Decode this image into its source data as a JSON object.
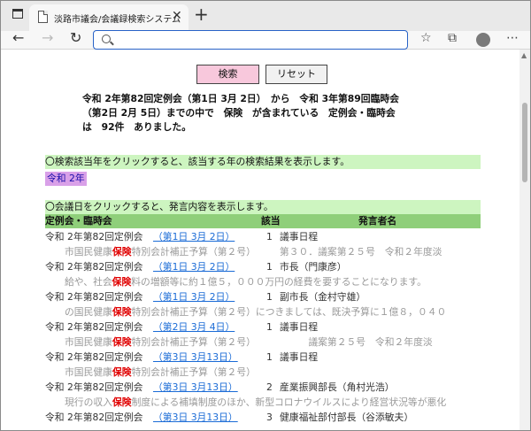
{
  "browser": {
    "tab_title": "淡路市議会/会議録検索システム",
    "close_glyph": "✕",
    "newtab_glyph": "+",
    "back_glyph": "←",
    "forward_glyph": "→",
    "reload_glyph": "↻",
    "addr_placeholder": ""
  },
  "search": {
    "button": "検索",
    "reset": "リセット"
  },
  "summary": [
    "令和 2年第82回定例会（第1日 3月 2日）　から　令和 3年第89回臨時会",
    "（第2日 2月 5日）までの中で　保険　が含まれている　定例会・臨時会",
    "は　92件　ありました。"
  ],
  "year_section": {
    "instruction": "〇検索該当年をクリックすると、該当する年の検索結果を表示します。",
    "year_link": "令和 2年"
  },
  "day_section": {
    "instruction": "〇会議日をクリックすると、発言内容を表示します。"
  },
  "table": {
    "headers": {
      "session": "定例会・臨時会",
      "count": "該当",
      "speaker": "発言者名"
    },
    "rows": [
      {
        "session": "令和 2年第82回定例会",
        "date": "（第1日 3月 2日）",
        "count": "1",
        "speaker": "議事日程",
        "excerpt": {
          "pre": "市国民健康",
          "kw": "保険",
          "post": "特別会計補正予算（第２号）　　　第３０．議案第２５号　令和２年度淡"
        }
      },
      {
        "session": "令和 2年第82回定例会",
        "date": "（第1日 3月 2日）",
        "count": "1",
        "speaker": "市長（門康彦）",
        "excerpt": {
          "pre": "給や、社会",
          "kw": "保険",
          "post": "料の増額等に約１億５，０００万円の経費を要することになります。"
        }
      },
      {
        "session": "令和 2年第82回定例会",
        "date": "（第1日 3月 2日）",
        "count": "1",
        "speaker": "副市長（金村守雄）",
        "excerpt": {
          "pre": "の国民健康",
          "kw": "保険",
          "post": "特別会計補正予算（第２号）につきましては、既決予算に１億８，０４０"
        }
      },
      {
        "session": "令和 2年第82回定例会",
        "date": "（第2日 3月 4日）",
        "count": "1",
        "speaker": "議事日程",
        "excerpt": {
          "pre": "市国民健康",
          "kw": "保険",
          "post": "特別会計補正予算（第２号）　　　　　　議案第２５号　令和２年度淡"
        }
      },
      {
        "session": "令和 2年第82回定例会",
        "date": "（第3日 3月13日）",
        "count": "1",
        "speaker": "議事日程",
        "excerpt": {
          "pre": "市国民健康",
          "kw": "保険",
          "post": "特別会計補正予算（第２号）"
        }
      },
      {
        "session": "令和 2年第82回定例会",
        "date": "（第3日 3月13日）",
        "count": "2",
        "speaker": "産業振興部長（角村光浩）",
        "excerpt": {
          "pre": "現行の収入",
          "kw": "保険",
          "post": "制度による補填制度のほか、新型コロナウイルスにより経営状況等が悪化"
        }
      },
      {
        "session": "令和 2年第82回定例会",
        "date": "（第3日 3月13日）",
        "count": "3",
        "speaker": "健康福祉部付部長（谷添敏夫）",
        "excerpt": null
      }
    ]
  },
  "colors": {
    "search_btn": "#f8c8dc",
    "band": "#cdf5c0",
    "header": "#8fcf7a",
    "year_link_bg": "#d9a0e8",
    "keyword": "#e00000",
    "link": "#1a6bd6"
  }
}
